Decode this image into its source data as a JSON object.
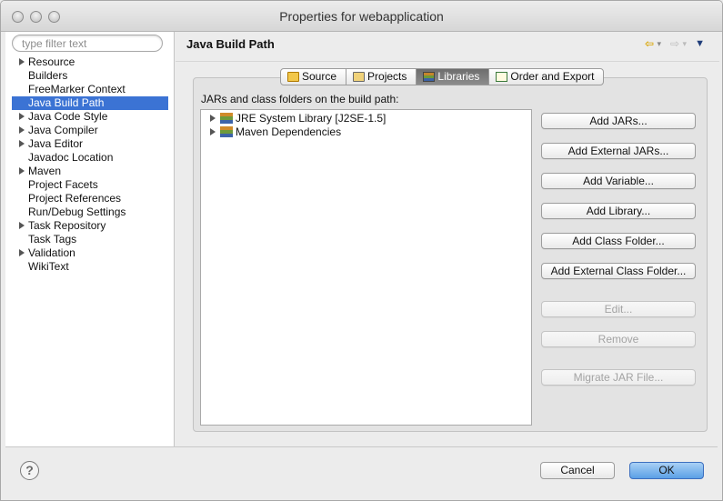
{
  "window": {
    "title": "Properties for webapplication"
  },
  "sidebar": {
    "filter_placeholder": "type filter text",
    "items": [
      {
        "label": "Resource",
        "expandable": true,
        "selected": false
      },
      {
        "label": "Builders",
        "expandable": false,
        "selected": false
      },
      {
        "label": "FreeMarker Context",
        "expandable": false,
        "selected": false
      },
      {
        "label": "Java Build Path",
        "expandable": false,
        "selected": true
      },
      {
        "label": "Java Code Style",
        "expandable": true,
        "selected": false
      },
      {
        "label": "Java Compiler",
        "expandable": true,
        "selected": false
      },
      {
        "label": "Java Editor",
        "expandable": true,
        "selected": false
      },
      {
        "label": "Javadoc Location",
        "expandable": false,
        "selected": false
      },
      {
        "label": "Maven",
        "expandable": true,
        "selected": false
      },
      {
        "label": "Project Facets",
        "expandable": false,
        "selected": false
      },
      {
        "label": "Project References",
        "expandable": false,
        "selected": false
      },
      {
        "label": "Run/Debug Settings",
        "expandable": false,
        "selected": false
      },
      {
        "label": "Task Repository",
        "expandable": true,
        "selected": false
      },
      {
        "label": "Task Tags",
        "expandable": false,
        "selected": false
      },
      {
        "label": "Validation",
        "expandable": true,
        "selected": false
      },
      {
        "label": "WikiText",
        "expandable": false,
        "selected": false
      }
    ]
  },
  "main": {
    "page_title": "Java Build Path",
    "nav": {
      "back_icon": "back-arrow-icon",
      "forward_icon": "forward-arrow-icon",
      "menu_icon": "view-menu-icon"
    },
    "tabs": [
      {
        "label": "Source",
        "icon": "source-folder-icon",
        "active": false
      },
      {
        "label": "Projects",
        "icon": "projects-icon",
        "active": false
      },
      {
        "label": "Libraries",
        "icon": "libraries-icon",
        "active": true
      },
      {
        "label": "Order and Export",
        "icon": "order-export-icon",
        "active": false
      }
    ],
    "section_label": "JARs and class folders on the build path:",
    "entries": [
      {
        "label": "JRE System Library [J2SE-1.5]",
        "icon": "library-icon"
      },
      {
        "label": "Maven Dependencies",
        "icon": "library-icon"
      }
    ],
    "buttons": [
      {
        "label": "Add JARs...",
        "enabled": true
      },
      {
        "label": "Add External JARs...",
        "enabled": true
      },
      {
        "label": "Add Variable...",
        "enabled": true
      },
      {
        "label": "Add Library...",
        "enabled": true
      },
      {
        "label": "Add Class Folder...",
        "enabled": true
      },
      {
        "label": "Add External Class Folder...",
        "enabled": true
      },
      {
        "label": "Edit...",
        "enabled": false
      },
      {
        "label": "Remove",
        "enabled": false
      },
      {
        "label": "Migrate JAR File...",
        "enabled": false
      }
    ]
  },
  "footer": {
    "help_label": "?",
    "cancel_label": "Cancel",
    "ok_label": "OK"
  },
  "colors": {
    "selection": "#3b73d4",
    "default_button": "#5ba0e6"
  }
}
